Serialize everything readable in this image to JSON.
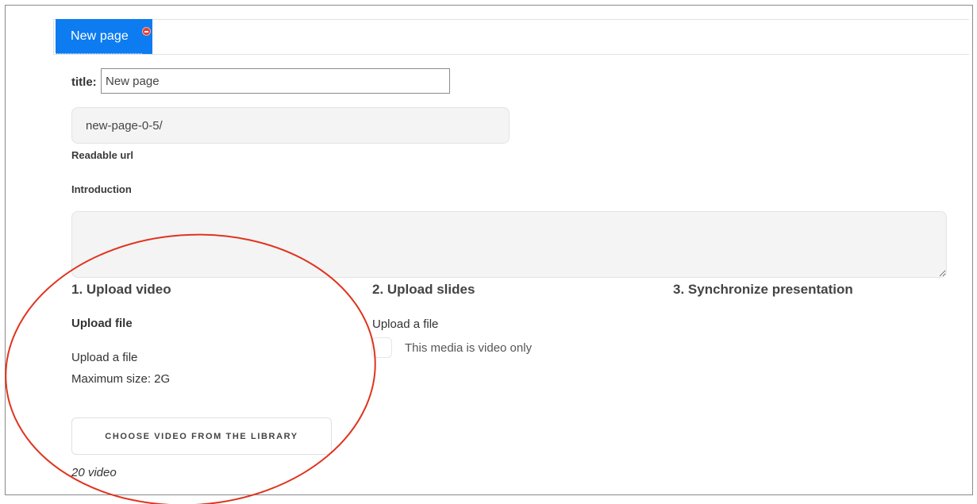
{
  "tab": {
    "label": "New page"
  },
  "form": {
    "title_label": "title:",
    "title_value": "New page",
    "url_value": "new-page-0-5/",
    "readable_url_label": "Readable url",
    "introduction_label": "Introduction",
    "introduction_value": ""
  },
  "steps": {
    "upload_video": "1. Upload video",
    "upload_slides": "2. Upload slides",
    "synchronize": "3. Synchronize presentation"
  },
  "video": {
    "upload_file_heading": "Upload file",
    "upload_link": "Upload a file",
    "max_size": "Maximum size: 2G",
    "library_button": "CHOOSE VIDEO FROM THE LIBRARY",
    "count": "20 video"
  },
  "slides": {
    "upload_link": "Upload a file",
    "video_only_label": "This media is video only",
    "video_only_checked": false
  },
  "colors": {
    "tab_active": "#0d7cf0",
    "annotation": "#e0341e"
  }
}
